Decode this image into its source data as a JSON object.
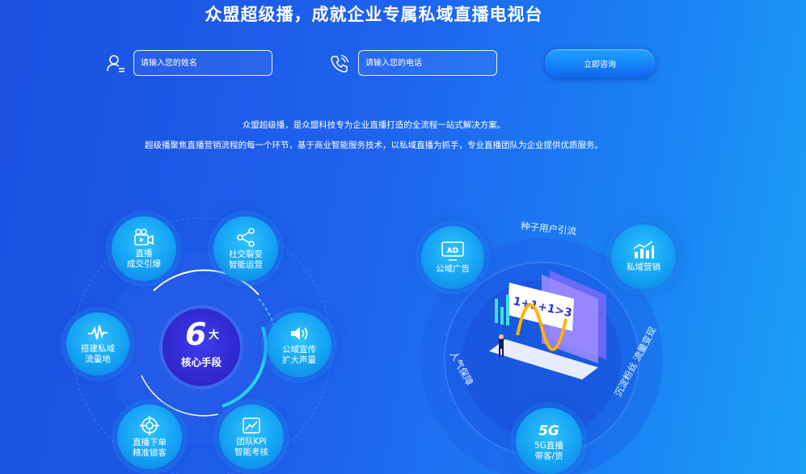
{
  "header": {
    "headline": "众盟超级播，成就企业专属私域直播电视台"
  },
  "form": {
    "name_placeholder": "请输入您的姓名",
    "phone_placeholder": "请输入您的电话",
    "submit_label": "立即咨询"
  },
  "description": {
    "line1": "众盟超级播，是众盟科技专为企业直播打造的全流程一站式解决方案。",
    "line2": "超级播聚焦直播营销流程的每一个环节，基于商业智能服务技术，以私域直播为抓手，专业直播团队为企业提供优质服务。"
  },
  "core_means": {
    "number": "6",
    "number_suffix": "大",
    "label": "核心手段",
    "items": [
      {
        "line1": "直播",
        "line2": "成交引爆",
        "icon": "video-camera-icon"
      },
      {
        "line1": "社交裂变",
        "line2": "智能运营",
        "icon": "share-icon"
      },
      {
        "line1": "搭建私域",
        "line2": "流量地",
        "icon": "pulse-icon"
      },
      {
        "line1": "公域宣传",
        "line2": "扩大声量",
        "icon": "speaker-icon"
      },
      {
        "line1": "直播下单",
        "line2": "精准锁客",
        "icon": "target-icon"
      },
      {
        "line1": "团队KPI",
        "line2": "智能考核",
        "icon": "chart-icon"
      }
    ]
  },
  "flywheel": {
    "nodes": [
      {
        "icon_text": "AD",
        "label": "公域广告",
        "icon": "ad-icon"
      },
      {
        "label": "私域营销",
        "icon": "bar-chart-icon"
      },
      {
        "icon_text": "5G",
        "line1": "5G直播",
        "line2": "带客/货",
        "icon": "5g-icon"
      }
    ],
    "arc_labels": {
      "top": "种子用户引流",
      "left": "人气保障",
      "right": "沉淀粉丝 流量变现"
    },
    "board_text": "1+1+1>3"
  }
}
